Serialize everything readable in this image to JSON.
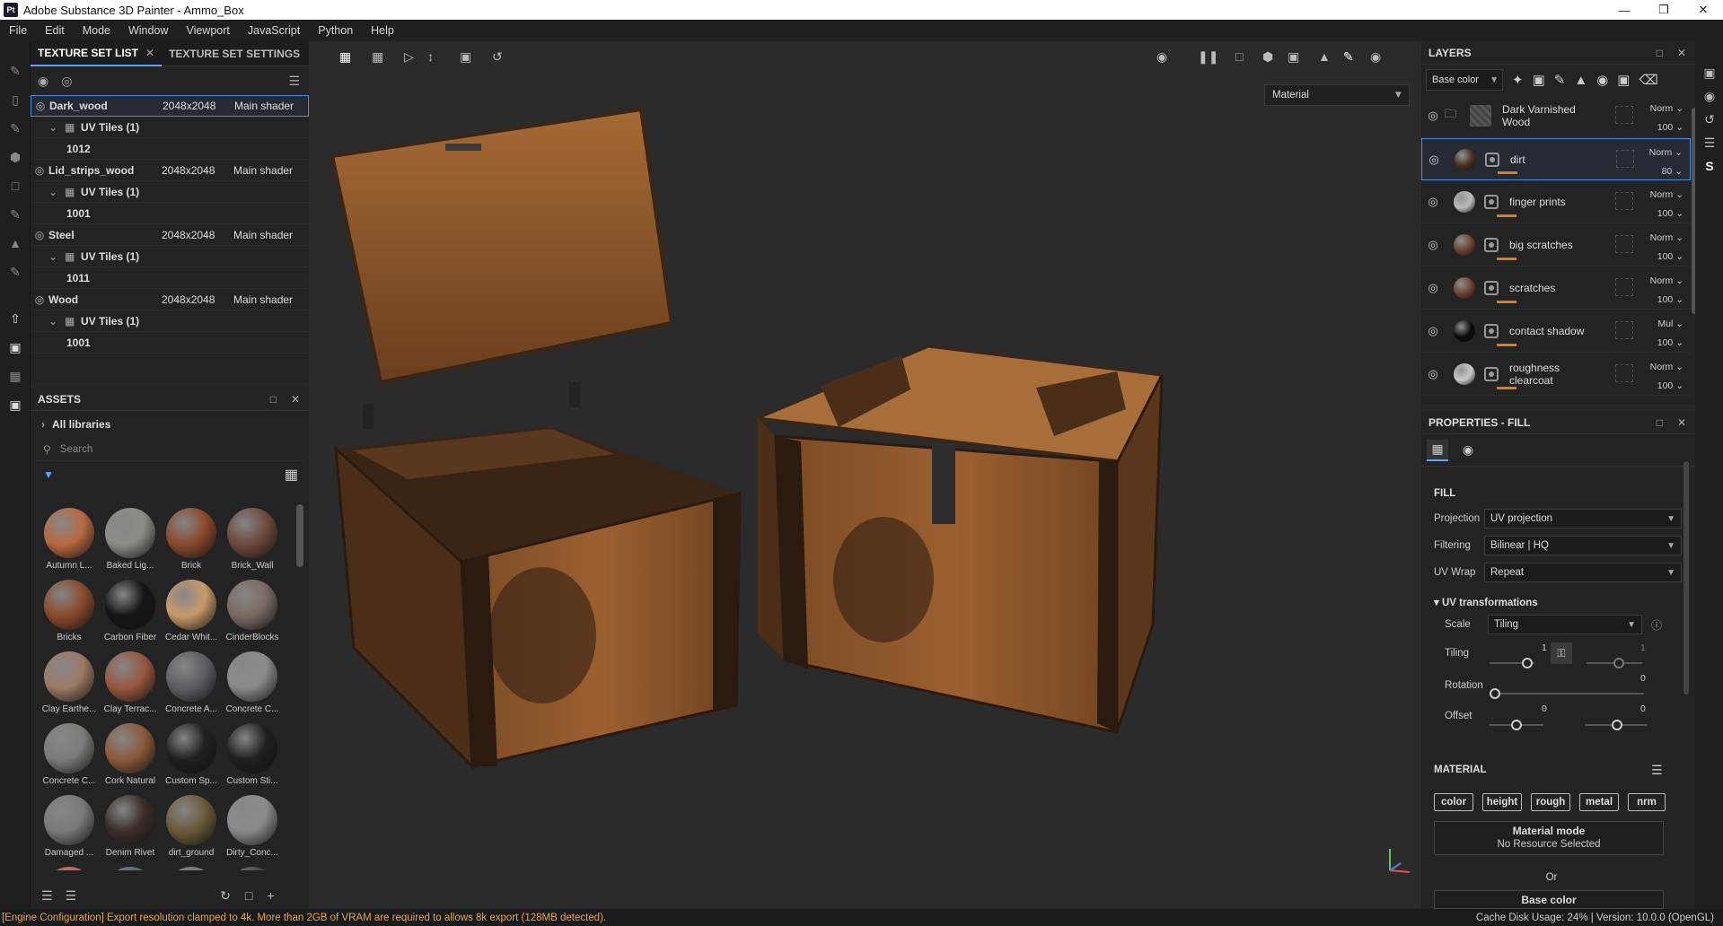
{
  "window": {
    "app_icon": "Pt",
    "title": "Adobe Substance 3D Painter - Ammo_Box"
  },
  "menu": [
    "File",
    "Edit",
    "Mode",
    "Window",
    "Viewport",
    "JavaScript",
    "Python",
    "Help"
  ],
  "texture_set": {
    "tabs": [
      "TEXTURE SET LIST",
      "TEXTURE SET SETTINGS"
    ],
    "sets": [
      {
        "name": "Dark_wood",
        "res": "2048x2048",
        "shader": "Main shader",
        "uv": "UV Tiles (1)",
        "tile": "1012",
        "selected": true
      },
      {
        "name": "Lid_strips_wood",
        "res": "2048x2048",
        "shader": "Main shader",
        "uv": "UV Tiles (1)",
        "tile": "1001",
        "selected": false
      },
      {
        "name": "Steel",
        "res": "2048x2048",
        "shader": "Main shader",
        "uv": "UV Tiles (1)",
        "tile": "1011",
        "selected": false
      },
      {
        "name": "Wood",
        "res": "2048x2048",
        "shader": "Main shader",
        "uv": "UV Tiles (1)",
        "tile": "1001",
        "selected": false
      }
    ]
  },
  "assets": {
    "title": "ASSETS",
    "library": "All libraries",
    "search_placeholder": "Search",
    "items": [
      {
        "label": "Autumn L...",
        "color": "#b86a40"
      },
      {
        "label": "Baked Lig...",
        "color": "#8f8c86"
      },
      {
        "label": "Brick",
        "color": "#8a4a2c"
      },
      {
        "label": "Brick_Wall",
        "color": "#6e4a3c"
      },
      {
        "label": "Bricks",
        "color": "#8a4a2c"
      },
      {
        "label": "Carbon Fiber",
        "color": "#151515"
      },
      {
        "label": "Cedar Whit...",
        "color": "#c79a6a"
      },
      {
        "label": "CinderBlocks",
        "color": "#7a6a62"
      },
      {
        "label": "Clay Earthe...",
        "color": "#9c7a66"
      },
      {
        "label": "Clay Terrac...",
        "color": "#985840"
      },
      {
        "label": "Concrete A...",
        "color": "#5d5f66"
      },
      {
        "label": "Concrete C...",
        "color": "#8a8a8a"
      },
      {
        "label": "Concrete C...",
        "color": "#7d7c78"
      },
      {
        "label": "Cork Natural",
        "color": "#8b5a3a"
      },
      {
        "label": "Custom Sp...",
        "color": "#202020"
      },
      {
        "label": "Custom Sti...",
        "color": "#202020"
      },
      {
        "label": "Damaged ...",
        "color": "#7a7a7a"
      },
      {
        "label": "Denim Rivet",
        "color": "#3a2e28"
      },
      {
        "label": "dirt_ground",
        "color": "#6a5a3a"
      },
      {
        "label": "Dirty_Conc...",
        "color": "#8a8a8a"
      },
      {
        "label": "",
        "color": "#d0605c"
      },
      {
        "label": "",
        "color": "#5b6580"
      },
      {
        "label": "",
        "color": "#777"
      },
      {
        "label": "",
        "color": "#444"
      }
    ]
  },
  "viewport": {
    "material_mode": "Material"
  },
  "layers": {
    "title": "LAYERS",
    "channel": "Base color",
    "items": [
      {
        "name": "Dark Varnished Wood",
        "blend": "Norm",
        "opacity": "100",
        "thumb": "#555",
        "folder": true,
        "selected": false
      },
      {
        "name": "dirt",
        "blend": "Norm",
        "opacity": "80",
        "thumb": "#4a3020",
        "folder": false,
        "selected": true
      },
      {
        "name": "finger prints",
        "blend": "Norm",
        "opacity": "100",
        "thumb": "#bbbbbb",
        "folder": false,
        "selected": false
      },
      {
        "name": "big scratches",
        "blend": "Norm",
        "opacity": "100",
        "thumb": "#6a4030",
        "folder": false,
        "selected": false
      },
      {
        "name": "scratches",
        "blend": "Norm",
        "opacity": "100",
        "thumb": "#6a4030",
        "folder": false,
        "selected": false
      },
      {
        "name": "contact shadow",
        "blend": "Mul",
        "opacity": "100",
        "thumb": "#0a0a0a",
        "folder": false,
        "selected": false
      },
      {
        "name": "roughness clearcoat",
        "blend": "Norm",
        "opacity": "100",
        "thumb": "#c8c8c8",
        "folder": false,
        "selected": false
      }
    ]
  },
  "properties": {
    "title": "PROPERTIES - FILL",
    "fill_label": "FILL",
    "projection": {
      "label": "Projection",
      "value": "UV projection"
    },
    "filtering": {
      "label": "Filtering",
      "value": "Bilinear | HQ"
    },
    "uvwrap": {
      "label": "UV Wrap",
      "value": "Repeat"
    },
    "uvtrans": "UV transformations",
    "scale": {
      "label": "Scale",
      "value": "Tiling"
    },
    "tiling": {
      "label": "Tiling",
      "v1": "1",
      "v2": "1"
    },
    "rotation": {
      "label": "Rotation",
      "value": "0"
    },
    "offset": {
      "label": "Offset",
      "v1": "0",
      "v2": "0"
    },
    "material_label": "MATERIAL",
    "channels": [
      "color",
      "height",
      "rough",
      "metal",
      "nrm"
    ],
    "material_mode": "Material mode",
    "no_resource": "No Resource Selected",
    "or": "Or",
    "base_color": "Base color"
  },
  "status": {
    "message": "[Engine Configuration] Export resolution clamped to 4k. More than 2GB of VRAM are required to allows 8k export (128MB detected).",
    "right": "Cache Disk Usage:   24% | Version: 10.0.0 (OpenGL)"
  }
}
